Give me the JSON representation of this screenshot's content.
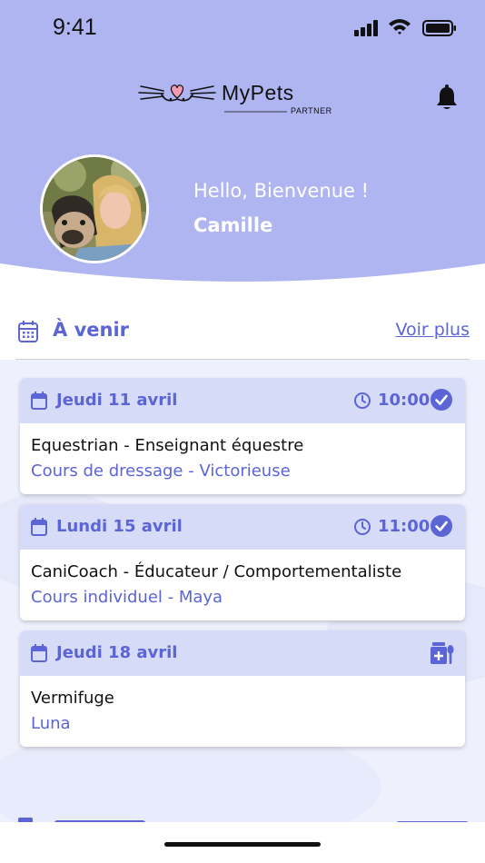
{
  "status_bar": {
    "time": "9:41"
  },
  "header": {
    "logo_text": "MyPets",
    "logo_sub": "PARTNER",
    "greeting": "Hello, Bienvenue !",
    "username": "Camille"
  },
  "upcoming": {
    "title": "À venir",
    "see_more": "Voir plus",
    "cards": [
      {
        "date": "Jeudi 11 avril",
        "time": "10:00",
        "title": "Equestrian - Enseignant équestre",
        "subtitle": "Cours de dressage - Victorieuse"
      },
      {
        "date": "Lundi 15 avril",
        "time": "11:00",
        "title": "CaniCoach - Éducateur / Comportementaliste",
        "subtitle": "Cours individuel - Maya"
      },
      {
        "date": "Jeudi 18 avril",
        "title": "Vermifuge",
        "subtitle": "Luna"
      }
    ]
  },
  "colors": {
    "header_bg": "#aeb5f0",
    "accent": "#5b65d6",
    "card_head": "#d6dbf8",
    "check": "#5b65d6"
  }
}
